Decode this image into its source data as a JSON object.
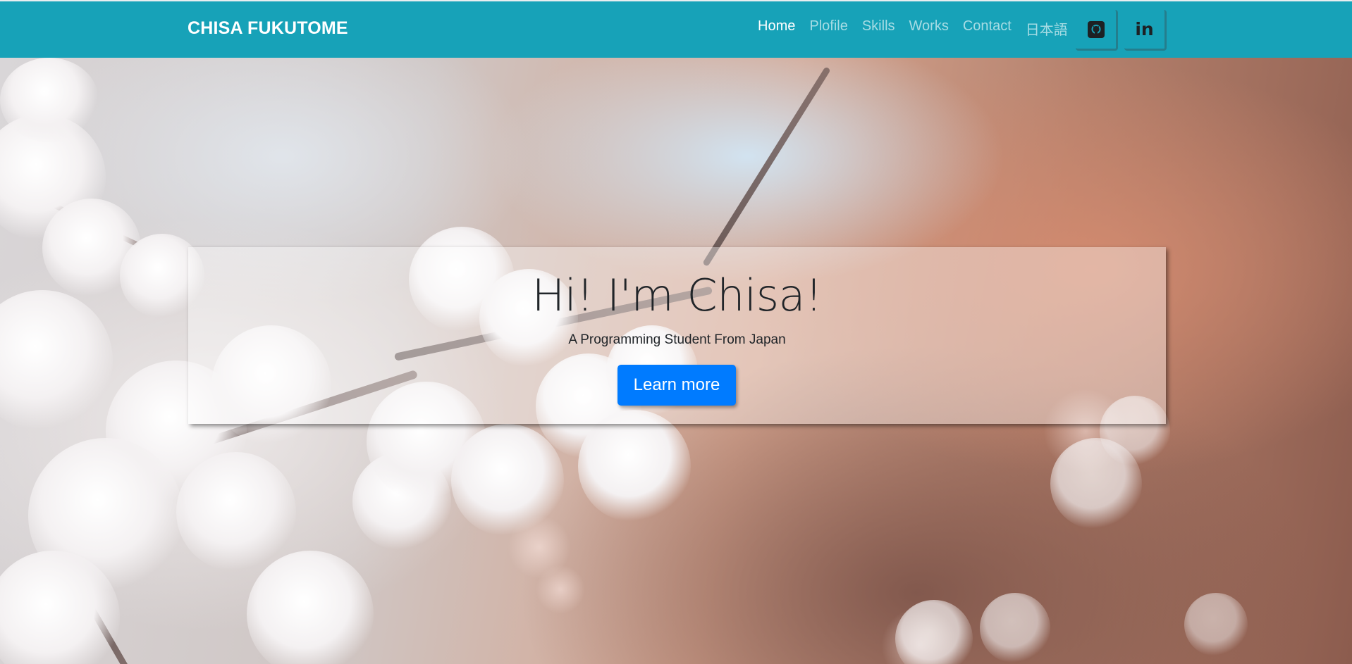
{
  "navbar": {
    "brand": "CHISA FUKUTOME",
    "links": [
      {
        "label": "Home",
        "active": true
      },
      {
        "label": "Plofile",
        "active": false
      },
      {
        "label": "Skills",
        "active": false
      },
      {
        "label": "Works",
        "active": false
      },
      {
        "label": "Contact",
        "active": false
      },
      {
        "label": "日本語",
        "active": false
      }
    ],
    "social": [
      {
        "icon": "github-icon"
      },
      {
        "icon": "linkedin-icon",
        "text": "in"
      }
    ],
    "background_color": "#17a2b8"
  },
  "hero": {
    "title": "Hi! I'm Chisa!",
    "subtitle": "A Programming Student From Japan",
    "button_label": "Learn more",
    "button_color": "#007bff",
    "background_image": "cherry-blossom-photo"
  }
}
